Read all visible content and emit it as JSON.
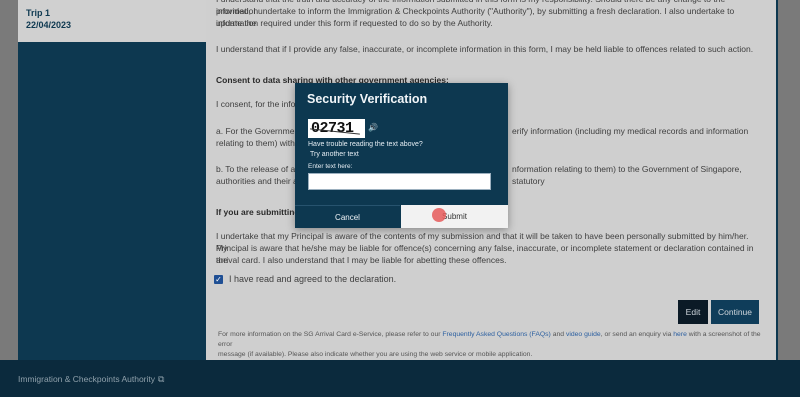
{
  "sidebar": {
    "trip_label": "Trip  1",
    "trip_date": "22/04/2023"
  },
  "content": {
    "para_top1": "I understand that the truth and accuracy of the information submitted in this form is my responsibility. Should there be any change to the information",
    "para_top2": "provided, I undertake to inform the Immigration & Checkpoints Authority (\"Authority\"), by submitting a fresh declaration. I also undertake to update the",
    "para_top3": "information required under this form if requested to do so by the Authority.",
    "para_liable": "I understand that if I provide any false, inaccurate, or incomplete information in this form, I may be held liable to offences related to such action.",
    "consent_heading": "Consent to data sharing with other government agencies:",
    "consent_intro": "I consent, for the infor",
    "para_a1": "a. For the Governmen",
    "para_a1_right": "erify information (including my medical records and information",
    "para_a2": "relating to them) with",
    "para_b1": "b. To the release of all",
    "para_b1_right": "nformation relating to them) to the Government of Singapore, statutory",
    "para_b2": "authorities and their a",
    "submitting_heading": "If you are submitting",
    "submitting_heading_end": ":",
    "principal1": "I undertake that my Principal is aware of the contents of my submission and that it will be taken to have been personally submitted by him/her. My",
    "principal2": "Principal is aware that he/she may be liable for offence(s) concerning any false, inaccurate, or incomplete statement or declaration contained in the",
    "principal3": "arrival card. I also understand that I may be liable for abetting these offences.",
    "declaration_label": "I have read and agreed to the declaration.",
    "edit_label": "Edit",
    "continue_label": "Continue",
    "footer_p1": "For more information on the SG Arrival Card e-Service, please refer to our ",
    "footer_faq": "Frequently Asked Questions (FAQs)",
    "footer_p2": " and ",
    "footer_guide": "video guide",
    "footer_p3": ", or send an enquiry via ",
    "footer_here": "here",
    "footer_p4": " with a screenshot of the error",
    "footer_line2": "message (if available). Please also indicate whether you are using the web service or mobile application."
  },
  "bottom_bar": {
    "authority": "Immigration & Checkpoints Authority"
  },
  "modal": {
    "title": "Security Verification",
    "captcha_text": "02731",
    "trouble_text": "Have trouble reading the text above?",
    "try_another": "Try another text",
    "enter_label": "Enter text here:",
    "input_value": "",
    "cancel_label": "Cancel",
    "submit_label": "Submit"
  },
  "icons": {
    "speaker": "speaker-icon",
    "external_link": "external-link-icon",
    "checkbox": "checkbox-checked-icon"
  },
  "colors": {
    "navy": "#0d3850",
    "link": "#2b5fa0",
    "checkbox": "#1f4f94"
  }
}
